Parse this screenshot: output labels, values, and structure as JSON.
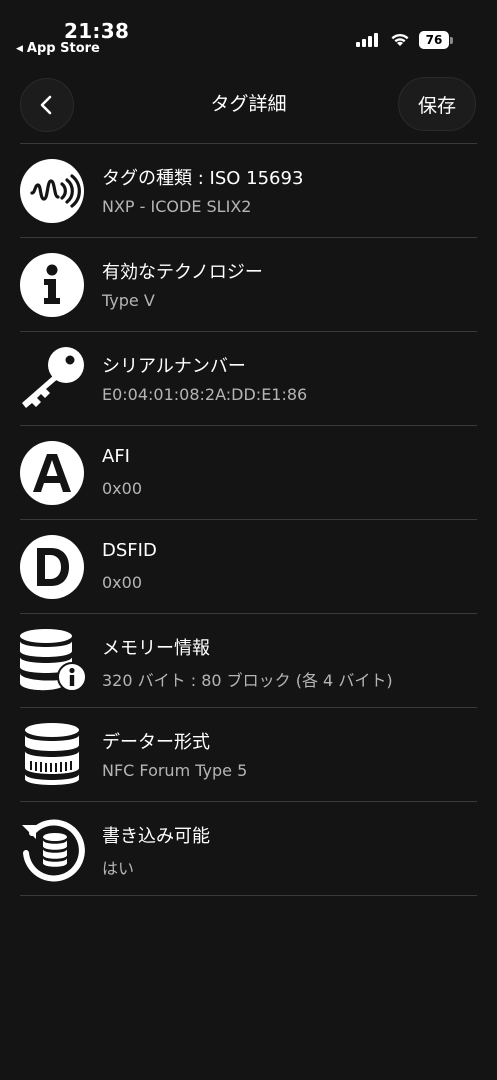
{
  "status": {
    "time": "21:38",
    "back_app": "App Store",
    "battery": "76",
    "battery_level": 0.76
  },
  "nav": {
    "title": "タグ詳細",
    "save_label": "保存"
  },
  "rows": [
    {
      "icon": "nfc-signal-icon",
      "title": "タグの種類 : ISO 15693",
      "value": "NXP - ICODE SLIX2"
    },
    {
      "icon": "info-icon",
      "title": "有効なテクノロジー",
      "value": "Type V"
    },
    {
      "icon": "key-icon",
      "title": "シリアルナンバー",
      "value": "E0:04:01:08:2A:DD:E1:86"
    },
    {
      "icon": "letter-a-icon",
      "title": "AFI",
      "value": "0x00"
    },
    {
      "icon": "letter-d-icon",
      "title": "DSFID",
      "value": "0x00"
    },
    {
      "icon": "database-info-icon",
      "title": "メモリー情報",
      "value": "320 バイト : 80 ブロック (各 4 バイト)"
    },
    {
      "icon": "database-icon",
      "title": "データー形式",
      "value": "NFC Forum Type 5"
    },
    {
      "icon": "database-refresh-icon",
      "title": "書き込み可能",
      "value": "はい"
    }
  ],
  "colors": {
    "background": "#141414",
    "divider": "#3a3a3a",
    "subtext": "#b5b5b5"
  }
}
